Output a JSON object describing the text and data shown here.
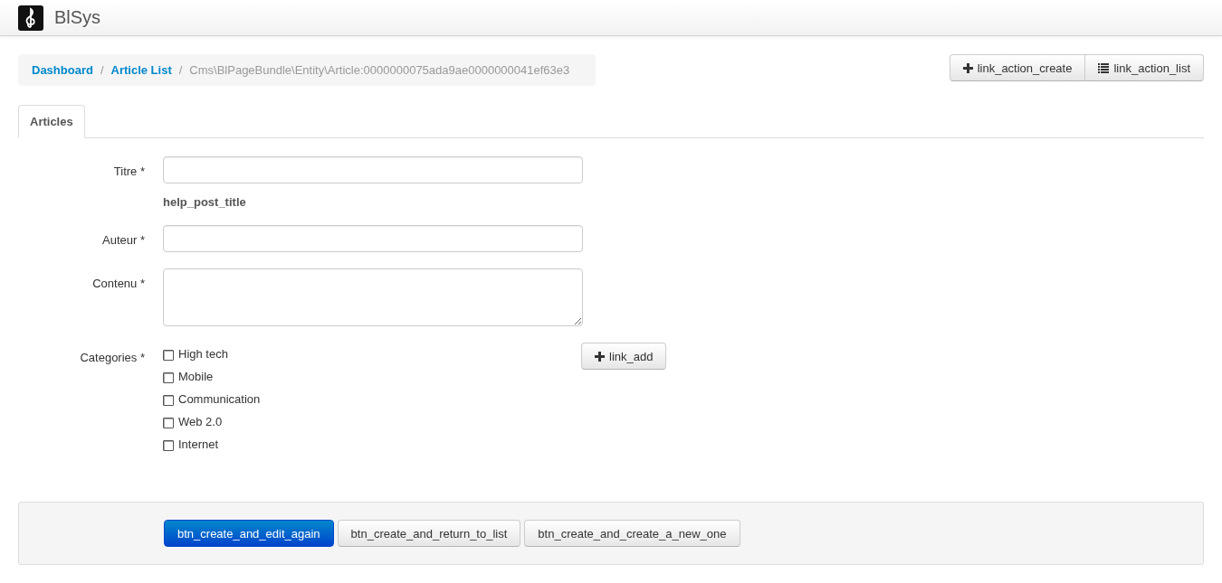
{
  "navbar": {
    "brand": "BlSys"
  },
  "breadcrumb": [
    {
      "label": "Dashboard",
      "kind": "link"
    },
    {
      "separator": "/",
      "label": "Article List",
      "kind": "link"
    },
    {
      "separator": "/",
      "label": "Cms\\BlPageBundle\\Entity\\Article:0000000075ada9ae0000000041ef63e3",
      "kind": "current"
    }
  ],
  "actions": [
    {
      "label": "link_action_create",
      "kind": "create"
    },
    {
      "label": "link_action_list",
      "kind": "list"
    }
  ],
  "tabs": [
    {
      "label": "Articles",
      "selected": true
    }
  ],
  "fields": [
    {
      "kind": "input",
      "label": "Titre *",
      "help": "help_post_title"
    },
    {
      "kind": "input",
      "label": "Auteur *"
    },
    {
      "kind": "textarea",
      "label": "Contenu *"
    },
    {
      "kind": "checkboxes",
      "label": "Categories *",
      "add_button": "link_add",
      "options": [
        {
          "label": "High tech",
          "checked": false
        },
        {
          "label": "Mobile",
          "checked": false
        },
        {
          "label": "Communication",
          "checked": false
        },
        {
          "label": "Web 2.0",
          "checked": false
        },
        {
          "label": "Internet",
          "checked": false
        }
      ]
    }
  ],
  "form_actions": [
    {
      "label": "btn_create_and_edit_again",
      "kind": "primary"
    },
    {
      "label": "btn_create_and_return_to_list",
      "kind": "default"
    },
    {
      "label": "btn_create_and_create_a_new_one",
      "kind": "default"
    }
  ]
}
